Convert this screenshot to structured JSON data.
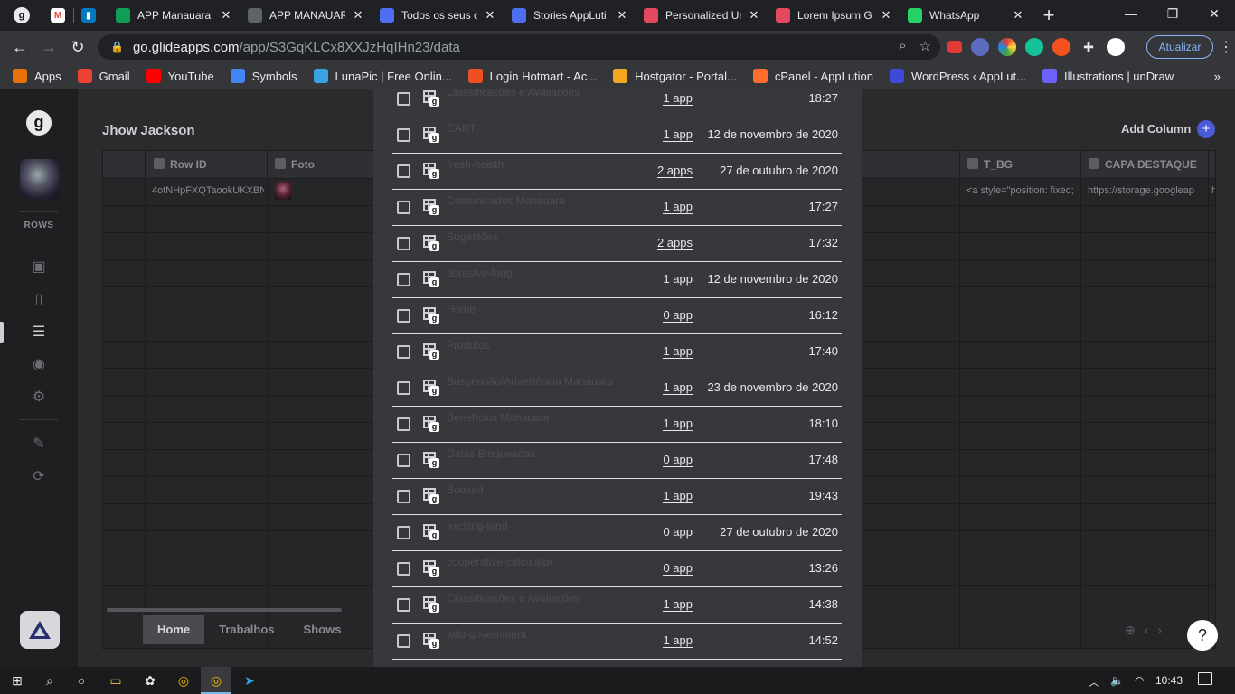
{
  "browser": {
    "tabs": [
      {
        "title": "APP Manauara",
        "icon": "google-sheets-icon",
        "color": "#0f9d58"
      },
      {
        "title": "APP MANAUAR",
        "icon": "globe-icon",
        "color": "#5f6368"
      },
      {
        "title": "Todos os seus c",
        "icon": "canva-icon",
        "color": "#4e6ef2"
      },
      {
        "title": "Stories AppLuti",
        "icon": "canva-icon",
        "color": "#4e6ef2"
      },
      {
        "title": "Personalized Ur",
        "icon": "m-logo-icon",
        "color": "#e2495f"
      },
      {
        "title": "Lorem Ipsum G",
        "icon": "pin-icon",
        "color": "#e2495f"
      },
      {
        "title": "WhatsApp",
        "icon": "whatsapp-icon",
        "color": "#25d366"
      }
    ],
    "url_host": "go.glideapps.com",
    "url_path": "/app/S3GqKLCx8XXJzHqIHn23/data",
    "update_label": "Atualizar",
    "bookmarks": [
      {
        "label": "Apps",
        "icon": "apps-grid-icon",
        "color": "#e8710a"
      },
      {
        "label": "Gmail",
        "icon": "gmail-icon",
        "color": "#ea4335"
      },
      {
        "label": "YouTube",
        "icon": "youtube-icon",
        "color": "#ff0000"
      },
      {
        "label": "Symbols",
        "icon": "check-icon",
        "color": "#4285f4"
      },
      {
        "label": "LunaPic | Free Onlin...",
        "icon": "lunapic-icon",
        "color": "#3aa3e3"
      },
      {
        "label": "Login Hotmart - Ac...",
        "icon": "fire-icon",
        "color": "#f04e23"
      },
      {
        "label": "Hostgator - Portal...",
        "icon": "gator-icon",
        "color": "#f5a623"
      },
      {
        "label": "cPanel - AppLution",
        "icon": "cpanel-icon",
        "color": "#ff6c2c"
      },
      {
        "label": "WordPress ‹ AppLut...",
        "icon": "triangle-icon",
        "color": "#3b4bd8"
      },
      {
        "label": "Illustrations | unDraw",
        "icon": "undraw-icon",
        "color": "#6c63ff"
      }
    ]
  },
  "app": {
    "sheet_title": "Jhow Jackson",
    "rows_label": "ROWS",
    "add_column": "Add Column",
    "columns": [
      "Row ID",
      "Foto",
      "T_BG",
      "CAPA DESTAQUE"
    ],
    "row_values": {
      "row_id": "4otNHpFXQTaookUKXBN",
      "t_bg": "<a style=\"position: fixed;",
      "capa": "https://storage.googleap",
      "extra": "h"
    },
    "bottom_tabs": [
      "Home",
      "Trabalhos",
      "Shows"
    ],
    "help": "?"
  },
  "modal": {
    "items": [
      {
        "name": "Classificações e Avaliações",
        "apps": "1 app",
        "date": "18:27"
      },
      {
        "name": "CART",
        "apps": "1 app",
        "date": "12 de novembro de 2020"
      },
      {
        "name": "fresh-health",
        "apps": "2 apps",
        "date": "27 de outubro de 2020"
      },
      {
        "name": "Comunicados Manauara",
        "apps": "1 app",
        "date": "17:27"
      },
      {
        "name": "Sugestões",
        "apps": "2 apps",
        "date": "17:32"
      },
      {
        "name": "abrasive-fang",
        "apps": "1 app",
        "date": "12 de novembro de 2020"
      },
      {
        "name": "Home",
        "apps": "0 app",
        "date": "16:12"
      },
      {
        "name": "Produtos",
        "apps": "1 app",
        "date": "17:40"
      },
      {
        "name": "Suspensão/Advertência Manauara",
        "apps": "1 app",
        "date": "23 de novembro de 2020"
      },
      {
        "name": "Benefícios Manauara",
        "apps": "1 app",
        "date": "18:10"
      },
      {
        "name": "Datas Bloqueadas",
        "apps": "0 app",
        "date": "17:48"
      },
      {
        "name": "Booked",
        "apps": "1 app",
        "date": "19:43"
      },
      {
        "name": "exciting-land",
        "apps": "0 app",
        "date": "27 de outubro de 2020"
      },
      {
        "name": "cooperative-calculator",
        "apps": "0 app",
        "date": "13:26"
      },
      {
        "name": "Classificações e Avaliações",
        "apps": "1 app",
        "date": "14:38"
      },
      {
        "name": "wild-government",
        "apps": "1 app",
        "date": "14:52"
      }
    ]
  },
  "taskbar": {
    "clock": "10:43"
  }
}
